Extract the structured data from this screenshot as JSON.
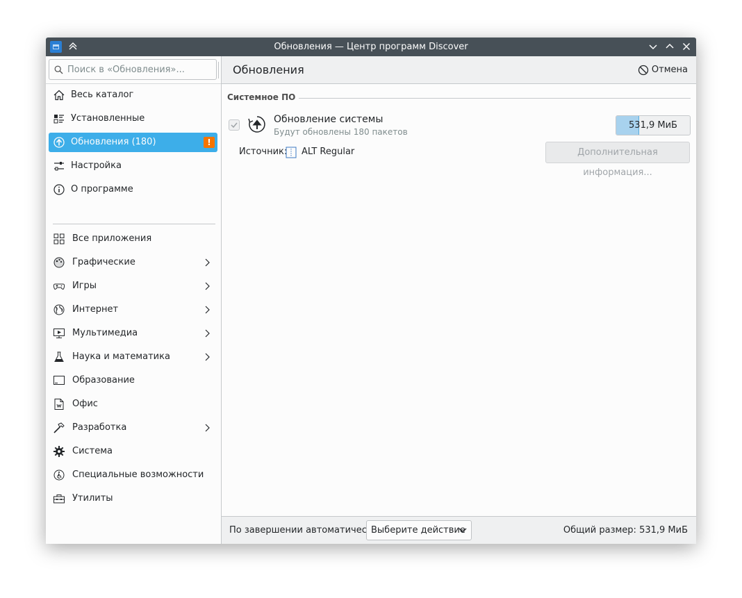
{
  "window": {
    "title": "Обновления — Центр программ Discover",
    "icon": "discover-app-icon",
    "controls": [
      "keep-above-icon",
      "minimize-icon",
      "maximize-icon",
      "close-icon"
    ]
  },
  "search": {
    "placeholder": "Поиск в «Обновления»..."
  },
  "sidebar": {
    "top_items": [
      {
        "label": "Весь каталог",
        "icon": "home-icon"
      },
      {
        "label": "Установленные",
        "icon": "installed-list-icon"
      },
      {
        "label": "Обновления (180)",
        "icon": "update-icon",
        "active": true,
        "badge": "!"
      },
      {
        "label": "Настройка",
        "icon": "settings-sliders-icon"
      },
      {
        "label": "О программе",
        "icon": "info-icon"
      }
    ],
    "categories": [
      {
        "label": "Все приложения",
        "icon": "grid-icon",
        "has_children": false
      },
      {
        "label": "Графические",
        "icon": "graphics-icon",
        "has_children": true
      },
      {
        "label": "Игры",
        "icon": "gamepad-icon",
        "has_children": true
      },
      {
        "label": "Интернет",
        "icon": "globe-icon",
        "has_children": true
      },
      {
        "label": "Мультимедиа",
        "icon": "multimedia-icon",
        "has_children": true
      },
      {
        "label": "Наука и математика",
        "icon": "flask-icon",
        "has_children": true
      },
      {
        "label": "Образование",
        "icon": "education-icon",
        "has_children": false
      },
      {
        "label": "Офис",
        "icon": "office-document-icon",
        "has_children": false
      },
      {
        "label": "Разработка",
        "icon": "hammer-icon",
        "has_children": true
      },
      {
        "label": "Система",
        "icon": "gear-icon",
        "has_children": false
      },
      {
        "label": "Специальные возможности",
        "icon": "accessibility-icon",
        "has_children": false
      },
      {
        "label": "Утилиты",
        "icon": "toolbox-icon",
        "has_children": false
      }
    ]
  },
  "header": {
    "title": "Обновления",
    "cancel_label": "Отмена"
  },
  "main": {
    "section_title": "Системное ПО",
    "update": {
      "name": "Обновление системы",
      "description": "Будут обновлены 180 пакетов",
      "size": "531,9 МиБ",
      "progress": 0.3,
      "checked": true
    },
    "source_label": "Источник:",
    "source_value": "ALT Regular",
    "more_info_label": "Дополнительная информация..."
  },
  "footer": {
    "auto_label": "По завершении автоматически:",
    "action_select": "Выберите действие",
    "total_size": "Общий размер: 531,9 МиБ"
  },
  "colors": {
    "accent": "#3daee9",
    "warning": "#f67400",
    "titlebar": "#475057"
  }
}
